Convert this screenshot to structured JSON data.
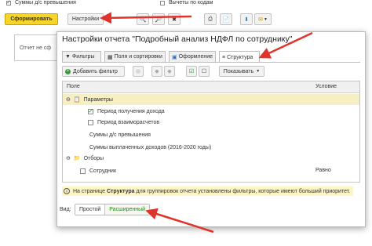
{
  "top": {
    "partial_label": "Суммы д/с превышения",
    "partial_label2": "Вычеты по кодам",
    "generate_label": "Сформировать",
    "settings_label": "Настройки",
    "left_note": "Отчет не сф"
  },
  "dialog": {
    "title": "Настройки отчета \"Подробный анализ НДФЛ по сотруднику\"",
    "tabs": [
      "Фильтры",
      "Поля и сортировки",
      "Оформление",
      "Структура"
    ],
    "add_filter_label": "Добавить фильтр",
    "show_label": "Показывать",
    "col_field": "Поле",
    "col_condition": "Условие",
    "rows": {
      "params": "Параметры",
      "period_income": "Период получения дохода",
      "period_settlement": "Период взаиморасчетов",
      "sum_excess": "Суммы д/с превышения",
      "sum_paid": "Суммы выплаченных доходов (2016-2020 годы)",
      "selections": "Отборы",
      "employee": "Сотрудник",
      "employee_condition": "Равно"
    },
    "info_prefix": "На странице ",
    "info_bold": "Структура",
    "info_suffix": " для группировок отчета установлены фильтры, которые имеют больший приоритет.",
    "view_label": "Вид:",
    "view_simple": "Простой",
    "view_extended": "Расширенный"
  },
  "colors": {
    "accent_yellow": "#f7d52b",
    "arrow_red": "#e0332b",
    "info_bg": "#fdf5c4",
    "selected_row": "#f7efc4",
    "extended_green": "#1e8a1e"
  }
}
